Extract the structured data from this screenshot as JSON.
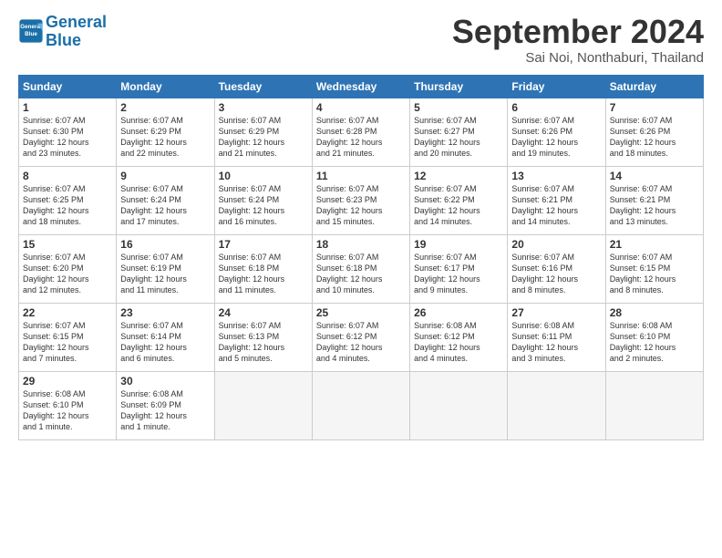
{
  "logo": {
    "line1": "General",
    "line2": "Blue"
  },
  "title": "September 2024",
  "location": "Sai Noi, Nonthaburi, Thailand",
  "days_of_week": [
    "Sunday",
    "Monday",
    "Tuesday",
    "Wednesday",
    "Thursday",
    "Friday",
    "Saturday"
  ],
  "weeks": [
    [
      {
        "day": "1",
        "info": "Sunrise: 6:07 AM\nSunset: 6:30 PM\nDaylight: 12 hours\nand 23 minutes."
      },
      {
        "day": "2",
        "info": "Sunrise: 6:07 AM\nSunset: 6:29 PM\nDaylight: 12 hours\nand 22 minutes."
      },
      {
        "day": "3",
        "info": "Sunrise: 6:07 AM\nSunset: 6:29 PM\nDaylight: 12 hours\nand 21 minutes."
      },
      {
        "day": "4",
        "info": "Sunrise: 6:07 AM\nSunset: 6:28 PM\nDaylight: 12 hours\nand 21 minutes."
      },
      {
        "day": "5",
        "info": "Sunrise: 6:07 AM\nSunset: 6:27 PM\nDaylight: 12 hours\nand 20 minutes."
      },
      {
        "day": "6",
        "info": "Sunrise: 6:07 AM\nSunset: 6:26 PM\nDaylight: 12 hours\nand 19 minutes."
      },
      {
        "day": "7",
        "info": "Sunrise: 6:07 AM\nSunset: 6:26 PM\nDaylight: 12 hours\nand 18 minutes."
      }
    ],
    [
      {
        "day": "8",
        "info": "Sunrise: 6:07 AM\nSunset: 6:25 PM\nDaylight: 12 hours\nand 18 minutes."
      },
      {
        "day": "9",
        "info": "Sunrise: 6:07 AM\nSunset: 6:24 PM\nDaylight: 12 hours\nand 17 minutes."
      },
      {
        "day": "10",
        "info": "Sunrise: 6:07 AM\nSunset: 6:24 PM\nDaylight: 12 hours\nand 16 minutes."
      },
      {
        "day": "11",
        "info": "Sunrise: 6:07 AM\nSunset: 6:23 PM\nDaylight: 12 hours\nand 15 minutes."
      },
      {
        "day": "12",
        "info": "Sunrise: 6:07 AM\nSunset: 6:22 PM\nDaylight: 12 hours\nand 14 minutes."
      },
      {
        "day": "13",
        "info": "Sunrise: 6:07 AM\nSunset: 6:21 PM\nDaylight: 12 hours\nand 14 minutes."
      },
      {
        "day": "14",
        "info": "Sunrise: 6:07 AM\nSunset: 6:21 PM\nDaylight: 12 hours\nand 13 minutes."
      }
    ],
    [
      {
        "day": "15",
        "info": "Sunrise: 6:07 AM\nSunset: 6:20 PM\nDaylight: 12 hours\nand 12 minutes."
      },
      {
        "day": "16",
        "info": "Sunrise: 6:07 AM\nSunset: 6:19 PM\nDaylight: 12 hours\nand 11 minutes."
      },
      {
        "day": "17",
        "info": "Sunrise: 6:07 AM\nSunset: 6:18 PM\nDaylight: 12 hours\nand 11 minutes."
      },
      {
        "day": "18",
        "info": "Sunrise: 6:07 AM\nSunset: 6:18 PM\nDaylight: 12 hours\nand 10 minutes."
      },
      {
        "day": "19",
        "info": "Sunrise: 6:07 AM\nSunset: 6:17 PM\nDaylight: 12 hours\nand 9 minutes."
      },
      {
        "day": "20",
        "info": "Sunrise: 6:07 AM\nSunset: 6:16 PM\nDaylight: 12 hours\nand 8 minutes."
      },
      {
        "day": "21",
        "info": "Sunrise: 6:07 AM\nSunset: 6:15 PM\nDaylight: 12 hours\nand 8 minutes."
      }
    ],
    [
      {
        "day": "22",
        "info": "Sunrise: 6:07 AM\nSunset: 6:15 PM\nDaylight: 12 hours\nand 7 minutes."
      },
      {
        "day": "23",
        "info": "Sunrise: 6:07 AM\nSunset: 6:14 PM\nDaylight: 12 hours\nand 6 minutes."
      },
      {
        "day": "24",
        "info": "Sunrise: 6:07 AM\nSunset: 6:13 PM\nDaylight: 12 hours\nand 5 minutes."
      },
      {
        "day": "25",
        "info": "Sunrise: 6:07 AM\nSunset: 6:12 PM\nDaylight: 12 hours\nand 4 minutes."
      },
      {
        "day": "26",
        "info": "Sunrise: 6:08 AM\nSunset: 6:12 PM\nDaylight: 12 hours\nand 4 minutes."
      },
      {
        "day": "27",
        "info": "Sunrise: 6:08 AM\nSunset: 6:11 PM\nDaylight: 12 hours\nand 3 minutes."
      },
      {
        "day": "28",
        "info": "Sunrise: 6:08 AM\nSunset: 6:10 PM\nDaylight: 12 hours\nand 2 minutes."
      }
    ],
    [
      {
        "day": "29",
        "info": "Sunrise: 6:08 AM\nSunset: 6:10 PM\nDaylight: 12 hours\nand 1 minute."
      },
      {
        "day": "30",
        "info": "Sunrise: 6:08 AM\nSunset: 6:09 PM\nDaylight: 12 hours\nand 1 minute."
      },
      {
        "day": "",
        "info": ""
      },
      {
        "day": "",
        "info": ""
      },
      {
        "day": "",
        "info": ""
      },
      {
        "day": "",
        "info": ""
      },
      {
        "day": "",
        "info": ""
      }
    ]
  ]
}
